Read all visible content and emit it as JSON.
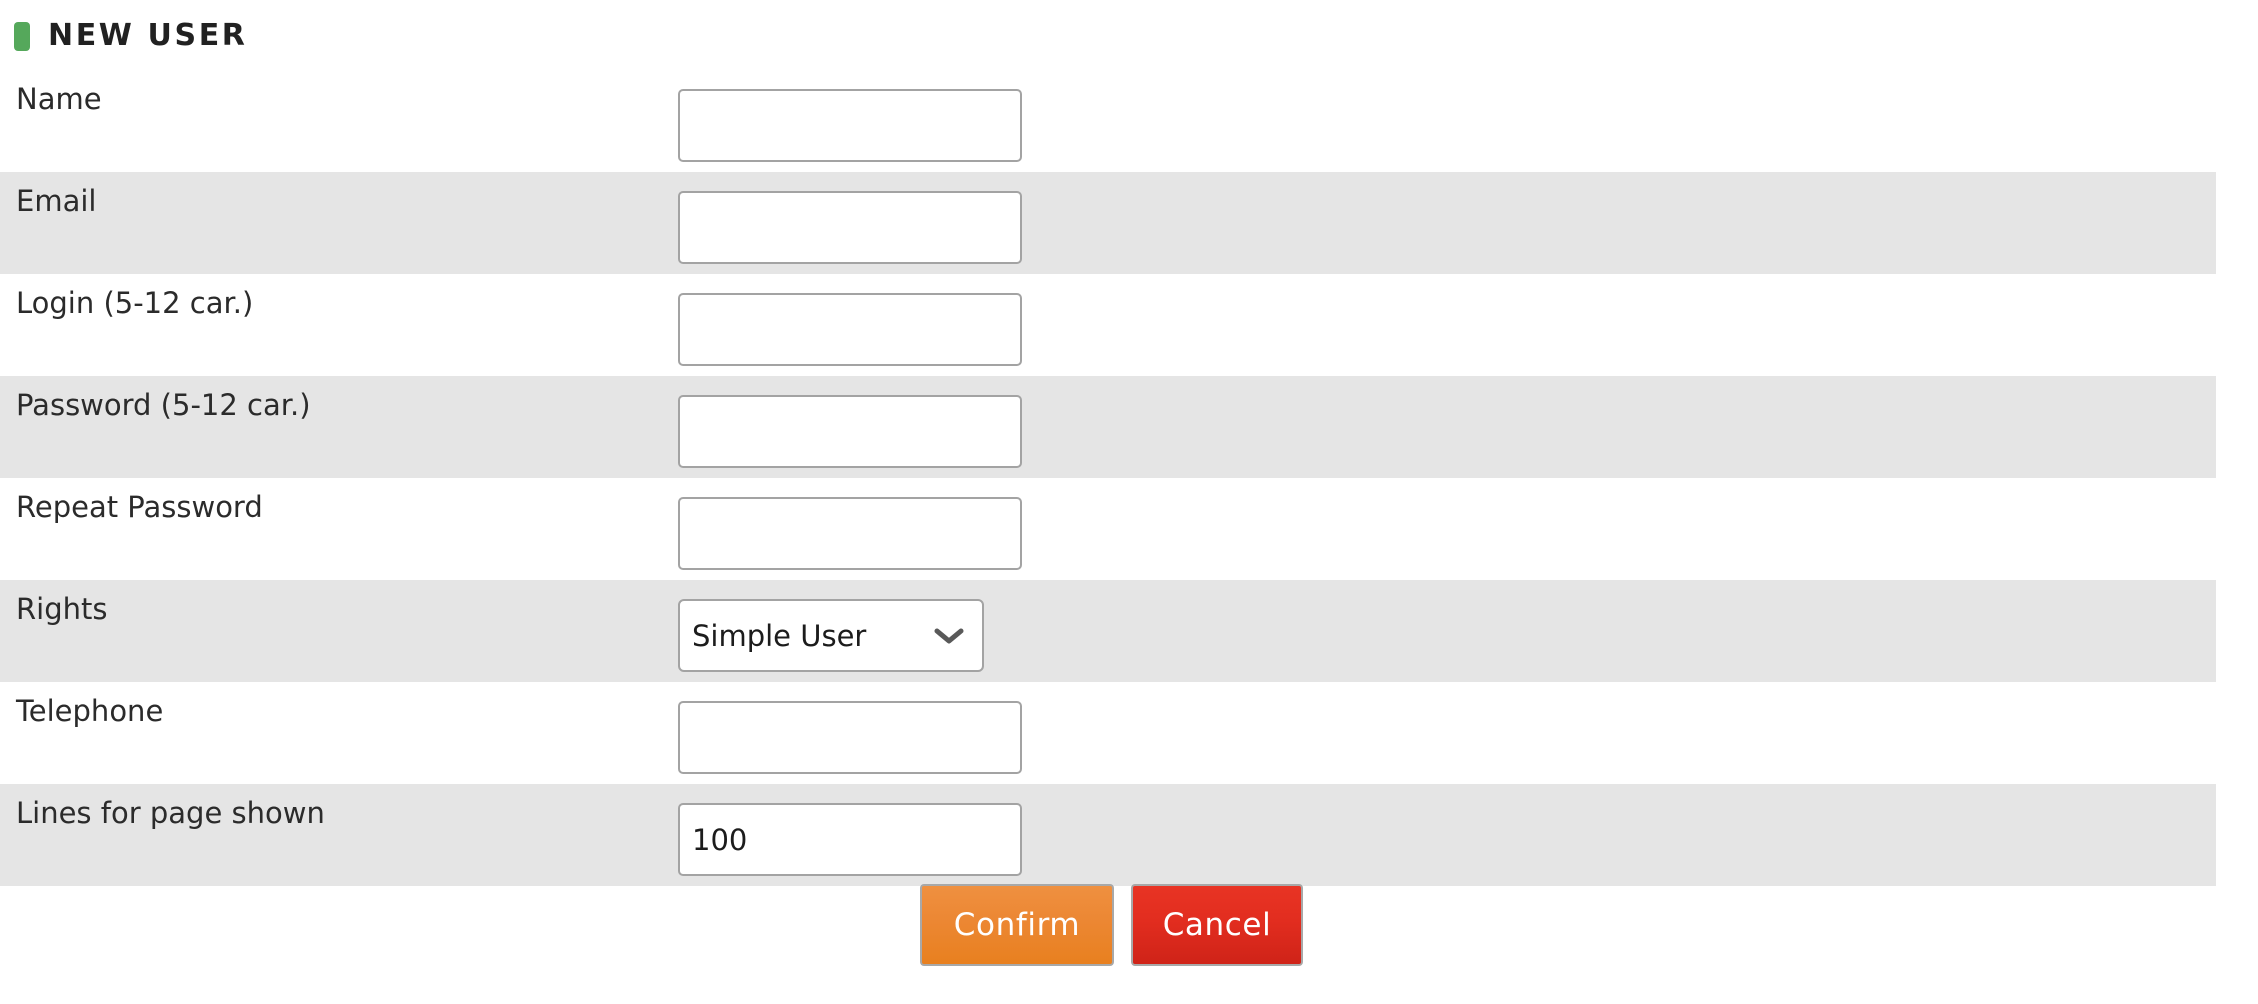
{
  "header": {
    "marker_color": "#55a85b",
    "title": "NEW USER"
  },
  "form": {
    "rows": [
      {
        "label": "Name",
        "control": "text",
        "value": "",
        "placeholder": ""
      },
      {
        "label": "Email",
        "control": "text",
        "value": "",
        "placeholder": ""
      },
      {
        "label": "Login (5-12 car.)",
        "control": "text",
        "value": "",
        "placeholder": ""
      },
      {
        "label": "Password (5-12 car.)",
        "control": "text",
        "value": "",
        "placeholder": ""
      },
      {
        "label": "Repeat Password",
        "control": "text",
        "value": "",
        "placeholder": ""
      },
      {
        "label": "Rights",
        "control": "select",
        "value": "Simple User",
        "placeholder": ""
      },
      {
        "label": "Telephone",
        "control": "text",
        "value": "",
        "placeholder": ""
      },
      {
        "label": "Lines for page shown",
        "control": "text",
        "value": "100",
        "placeholder": ""
      }
    ],
    "labels": {
      "name": "Name",
      "email": "Email",
      "login": "Login (5-12 car.)",
      "password": "Password (5-12 car.)",
      "repeat_password": "Repeat Password",
      "rights": "Rights",
      "telephone": "Telephone",
      "lines_for_page_shown": "Lines for page shown"
    },
    "values": {
      "name": "",
      "email": "",
      "login": "",
      "password": "",
      "repeat_password": "",
      "rights": "Simple User",
      "telephone": "",
      "lines_for_page_shown": "100"
    },
    "rights_icon": "chevron-down-icon"
  },
  "buttons": {
    "confirm": "Confirm",
    "cancel": "Cancel",
    "confirm_color": "#e8801f",
    "cancel_color": "#e22d1f"
  },
  "colors": {
    "row_alt_background": "#e5e5e5",
    "row_background": "#ffffff",
    "input_border": "#a3a3a3",
    "text": "#2b2b2b"
  }
}
